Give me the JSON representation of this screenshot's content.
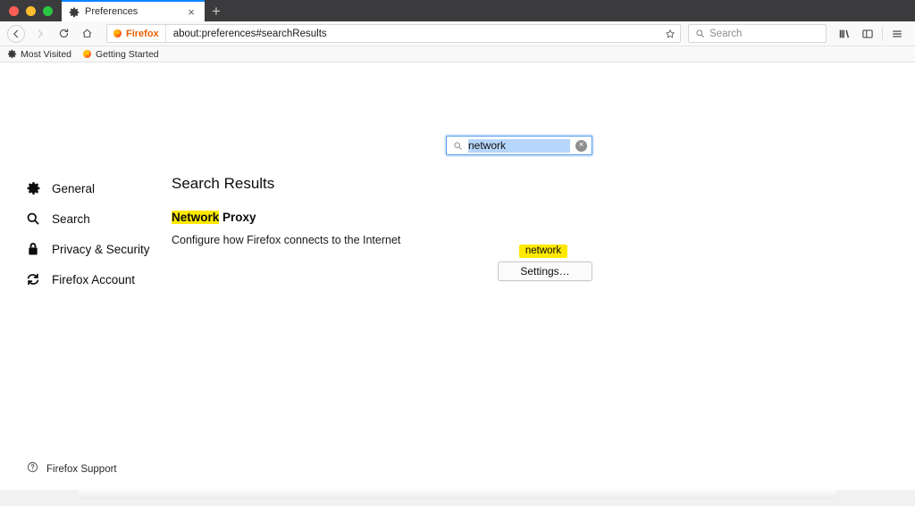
{
  "window": {
    "traffic_lights": [
      "close",
      "minimize",
      "maximize"
    ]
  },
  "tabbar": {
    "tabs": [
      {
        "title": "Preferences",
        "favicon": "gear-icon",
        "active": true,
        "close_label": "×"
      }
    ],
    "new_tab_label": "+"
  },
  "navbar": {
    "back_icon": "back-arrow-icon",
    "forward_icon": "forward-arrow-icon",
    "reload_icon": "reload-icon",
    "home_icon": "home-icon",
    "identity_label": "Firefox",
    "url": "about:preferences#searchResults",
    "bookmark_icon": "star-icon",
    "search_placeholder": "Search",
    "library_icon": "library-icon",
    "sidebar_icon": "sidebar-icon",
    "menu_icon": "hamburger-menu-icon"
  },
  "bookmarks": {
    "items": [
      {
        "label": "Most Visited",
        "icon": "gear-icon"
      },
      {
        "label": "Getting Started",
        "icon": "firefox-icon"
      }
    ]
  },
  "prefs_search": {
    "value": "network",
    "search_icon": "search-icon",
    "clear_icon": "clear-icon",
    "clear_glyph": "×"
  },
  "sidebar": {
    "items": [
      {
        "label": "General",
        "icon": "gear-icon"
      },
      {
        "label": "Search",
        "icon": "search-icon"
      },
      {
        "label": "Privacy & Security",
        "icon": "lock-icon"
      },
      {
        "label": "Firefox Account",
        "icon": "sync-icon"
      }
    ],
    "support": {
      "label": "Firefox Support",
      "icon": "help-circle-icon"
    }
  },
  "main": {
    "title": "Search Results",
    "results": [
      {
        "heading_highlight": "Network",
        "heading_rest": " Proxy",
        "description": "Configure how Firefox connects to the Internet",
        "tag": "network",
        "button": "Settings…"
      }
    ]
  },
  "colors": {
    "tab_accent": "#0a84ff",
    "highlight_yellow": "#ffe900",
    "selection_blue": "#b6d6fb",
    "firefox_orange": "#e96100",
    "focus_border": "#4f9bea"
  }
}
